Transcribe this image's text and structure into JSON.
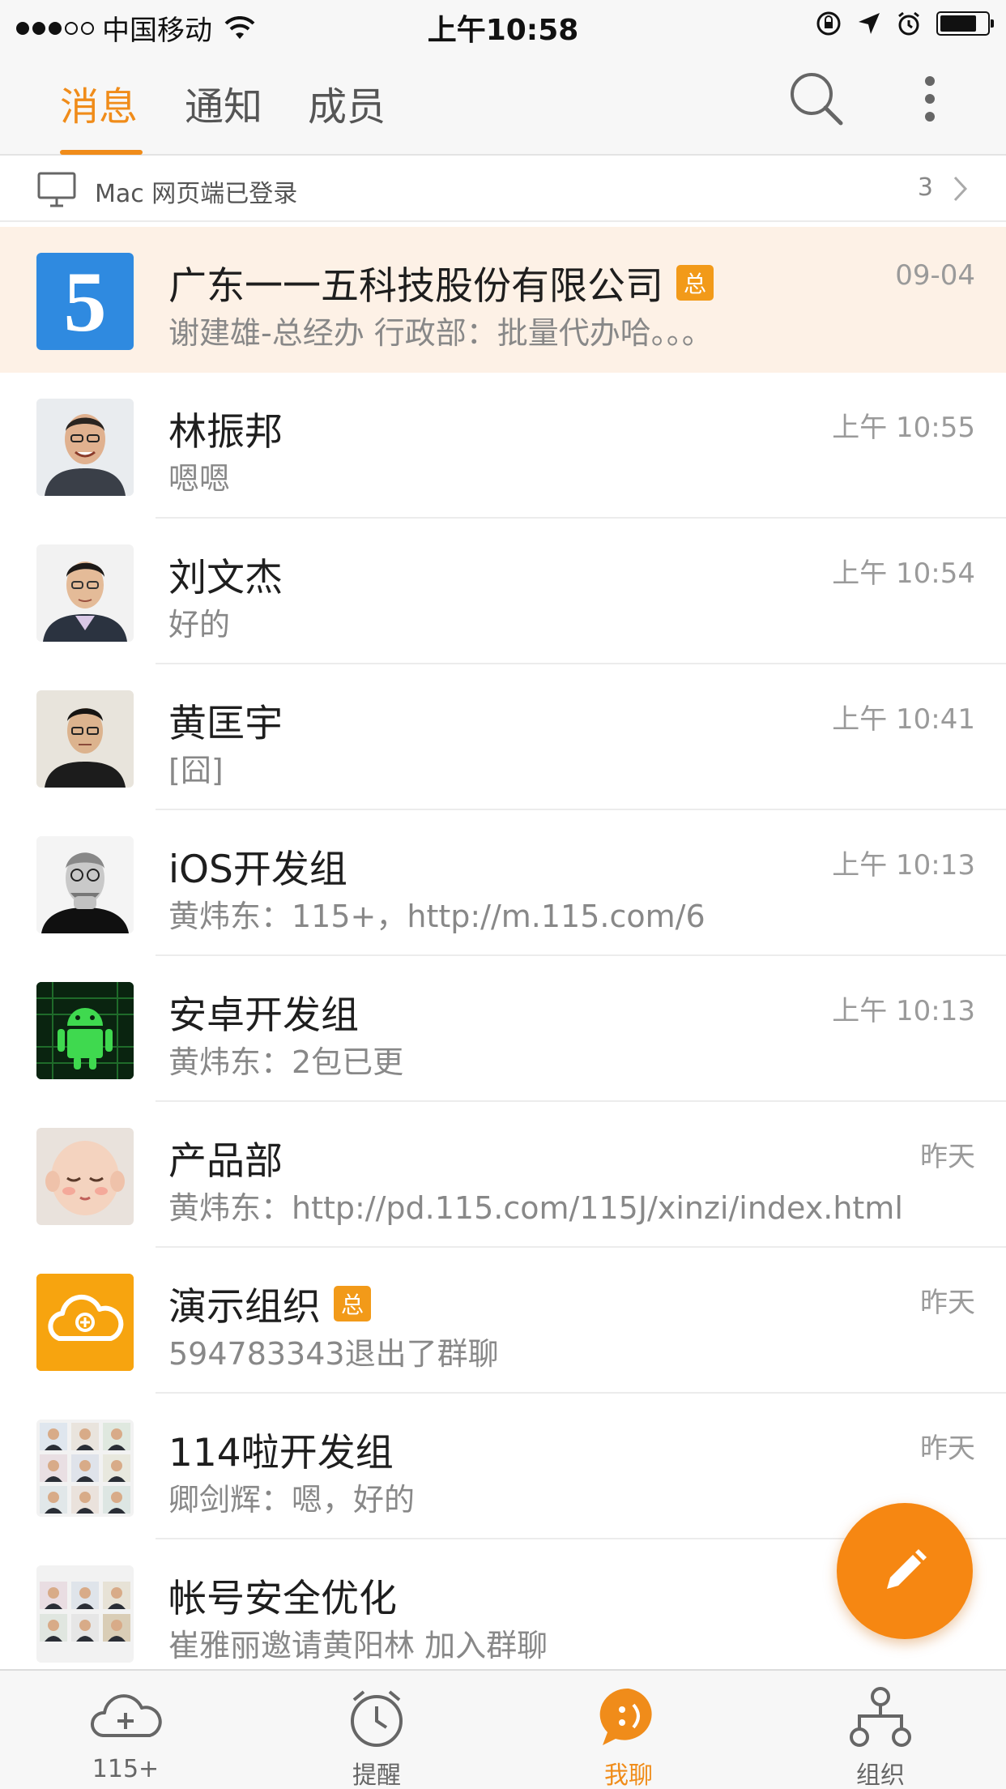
{
  "status_bar": {
    "carrier": "中国移动",
    "time": "上午10:58"
  },
  "tabs": [
    {
      "label": "消息",
      "active": true
    },
    {
      "label": "通知",
      "active": false
    },
    {
      "label": "成员",
      "active": false
    }
  ],
  "header_icons": [
    "search-icon",
    "more-vertical-icon"
  ],
  "login_banner": {
    "label": "Mac 网页端已登录",
    "count": "3"
  },
  "conversations": [
    {
      "name": "广东一一五科技股份有限公司",
      "badge": "总",
      "preview": "谢建雄-总经办 行政部：批量代办哈。。。",
      "time": "09-04",
      "pinned": true,
      "avatar": "company-logo"
    },
    {
      "name": "林振邦",
      "preview": "嗯嗯",
      "time": "上午 10:55",
      "avatar": "person-photo"
    },
    {
      "name": "刘文杰",
      "preview": "好的",
      "time": "上午 10:54",
      "avatar": "person-photo"
    },
    {
      "name": "黄匡宇",
      "preview": "[囧]",
      "time": "上午 10:41",
      "avatar": "person-photo"
    },
    {
      "name": "iOS开发组",
      "preview": "黄炜东：115+，http://m.115.com/6",
      "time": "上午 10:13",
      "avatar": "person-photo"
    },
    {
      "name": "安卓开发组",
      "preview": "黄炜东：2包已更",
      "time": "上午 10:13",
      "avatar": "android-logo"
    },
    {
      "name": "产品部",
      "preview": "黄炜东：http://pd.115.com/115J/xinzi/index.html",
      "time": "昨天",
      "avatar": "cartoon-face"
    },
    {
      "name": "演示组织",
      "badge": "总",
      "preview": "594783343退出了群聊",
      "time": "昨天",
      "avatar": "cloud-logo"
    },
    {
      "name": "114啦开发组",
      "preview": "卿剑辉：嗯，好的",
      "time": "昨天",
      "avatar": "group-grid"
    },
    {
      "name": "帐号安全优化",
      "preview": "崔雅丽邀请黄阳林 加入群聊",
      "time": "",
      "avatar": "group-grid"
    }
  ],
  "fab_icon": "pencil-icon",
  "bottom_nav": [
    {
      "label": "115+",
      "icon": "cloud-plus-icon",
      "active": false
    },
    {
      "label": "提醒",
      "icon": "alarm-clock-icon",
      "active": false
    },
    {
      "label": "我聊",
      "icon": "chat-smile-icon",
      "active": true
    },
    {
      "label": "组织",
      "icon": "org-tree-icon",
      "active": false
    }
  ],
  "colors": {
    "accent": "#f08c1a",
    "pinned_bg": "#fdf1e6",
    "fab": "#f68712",
    "badge": "#f29a19"
  }
}
